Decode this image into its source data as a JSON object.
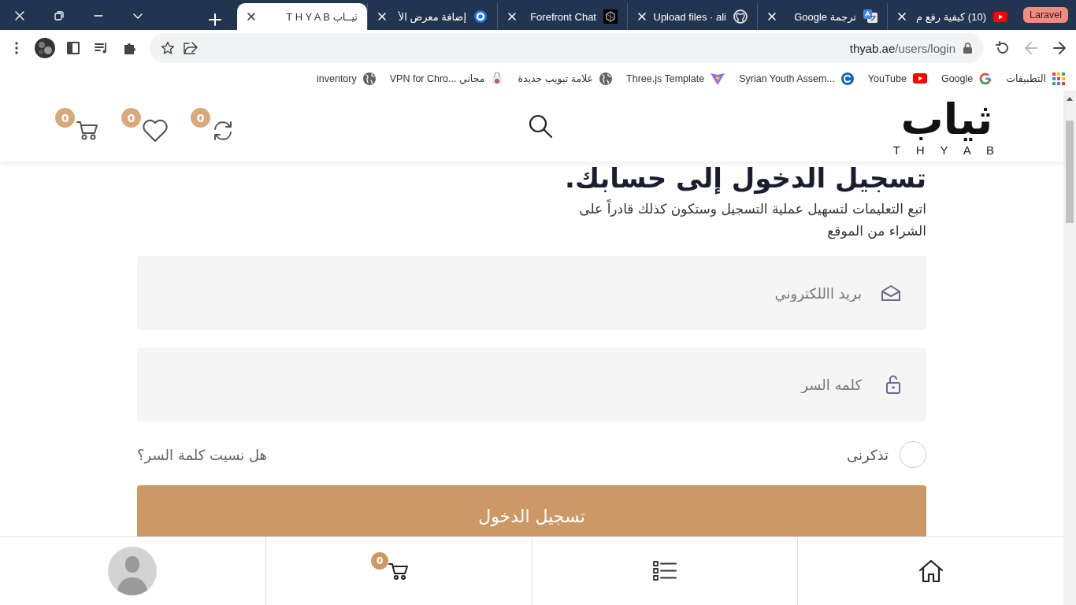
{
  "browser": {
    "window_controls": [
      {
        "kind": "close"
      },
      {
        "kind": "restore"
      },
      {
        "kind": "minimize"
      },
      {
        "kind": "caret"
      }
    ],
    "tab_group": {
      "label": "Laravel",
      "color": "#f28b82"
    },
    "tabs": [
      {
        "title": "(10) كيفية رفع م",
        "kind": "youtube",
        "selected": false
      },
      {
        "title": "ترجمة Google",
        "kind": "translate",
        "selected": false
      },
      {
        "title": "Upload files · ali",
        "kind": "github",
        "selected": false
      },
      {
        "title": "Forefront Chat",
        "kind": "forefront",
        "selected": false
      },
      {
        "title": "إضافة معرض الأ",
        "kind": "ring",
        "selected": false
      },
      {
        "title": "ثيــاب T H Y A B",
        "kind": "none",
        "selected": true
      }
    ],
    "address": {
      "host": "thyab.ae",
      "path": "/users/login"
    },
    "back_disabled": true,
    "bookmarks": [
      {
        "label": "التطبيقات",
        "kind": "apps"
      },
      {
        "label": "Google",
        "kind": "google"
      },
      {
        "label": "YouTube",
        "kind": "youtube"
      },
      {
        "label": "Syrian Youth Assem...",
        "kind": "c-logo"
      },
      {
        "label": "Three.js Template",
        "kind": "vite"
      },
      {
        "label": "علامة تبويب جديدة",
        "kind": "globe"
      },
      {
        "label": "VPN for Chro... مجاني",
        "kind": "store"
      },
      {
        "label": "inventory",
        "kind": "globe"
      }
    ]
  },
  "header": {
    "logo": "ثياب",
    "logo_latin": "T H Y A B",
    "counters": [
      {
        "kind": "compare",
        "count": "0"
      },
      {
        "kind": "wishlist",
        "count": "0"
      },
      {
        "kind": "cart",
        "count": "0"
      }
    ]
  },
  "login": {
    "title": "تسجيل الدخول إلى حسابك.",
    "intro": "اتبع التعليمات لتسهيل عملية التسجيل وستكون كذلك قادراً على الشراء من الموقع",
    "email_placeholder": "بريد االلكتروني",
    "password_placeholder": "كلمه السر",
    "remember": {
      "label": "تذكرنى",
      "checked": false
    },
    "forgot": "هل نسيت كلمة السر؟",
    "submit": "تسجيل الدخول"
  },
  "bottom_nav": [
    {
      "kind": "home"
    },
    {
      "kind": "list"
    },
    {
      "kind": "cart",
      "count": "0"
    },
    {
      "kind": "account"
    }
  ]
}
